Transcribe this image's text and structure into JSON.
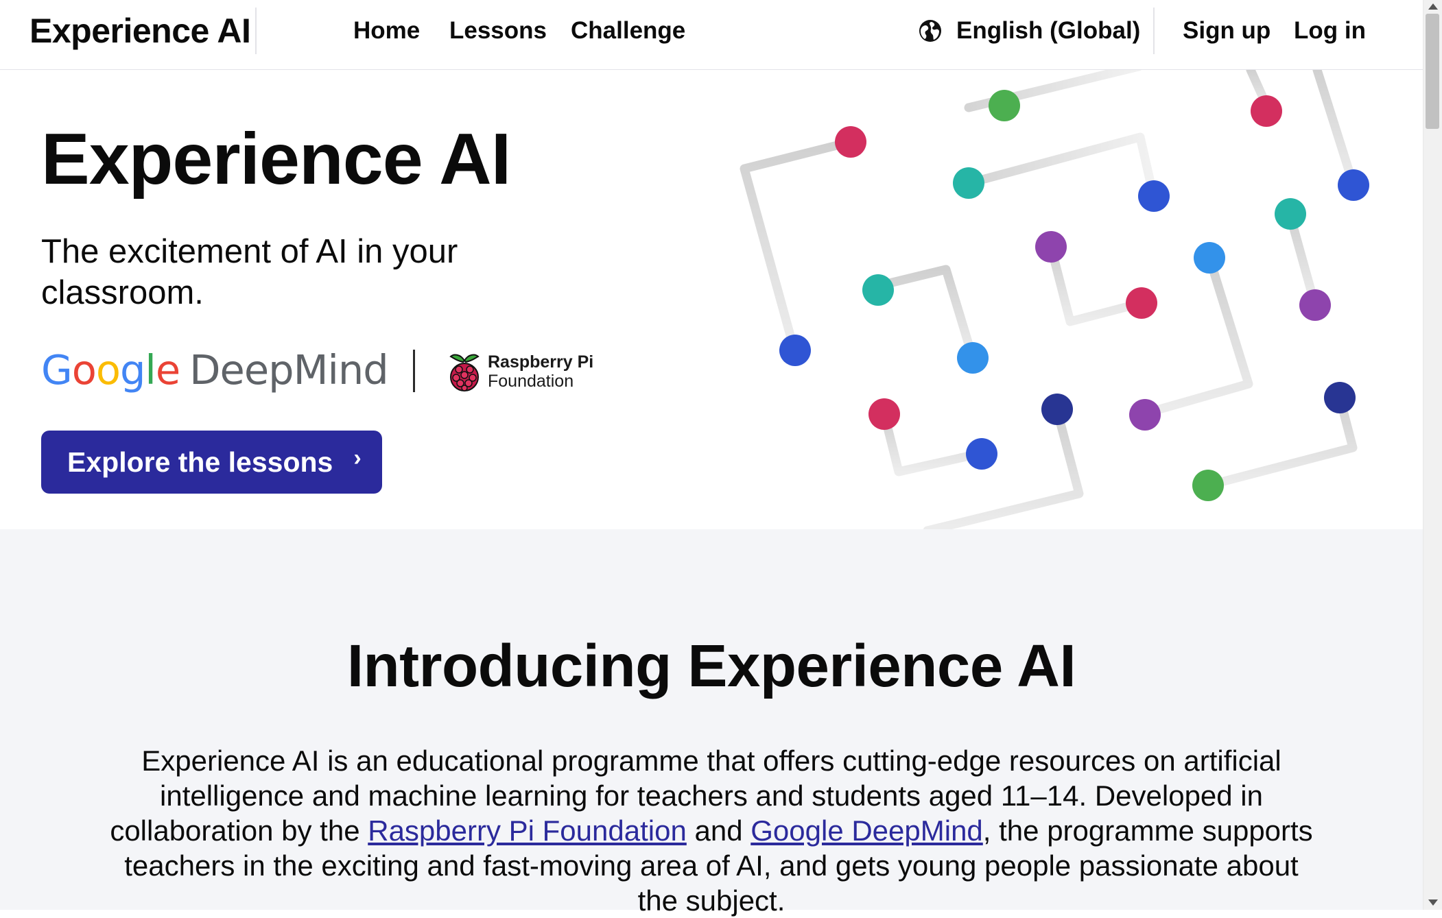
{
  "header": {
    "brand": "Experience AI",
    "nav": [
      {
        "label": "Home"
      },
      {
        "label": "Lessons"
      },
      {
        "label": "Challenge"
      }
    ],
    "language": {
      "label": "English (Global)",
      "icon": "globe-icon"
    },
    "sign_up": "Sign up",
    "log_in": "Log in"
  },
  "hero": {
    "title": "Experience AI",
    "subtitle": "The excitement of AI in your classroom.",
    "partner_logos": {
      "google_deepmind": {
        "google": "Google",
        "deepmind": "DeepMind"
      },
      "raspberry_pi": {
        "line1": "Raspberry Pi",
        "line2": "Foundation",
        "icon": "raspberry-icon"
      }
    },
    "cta": {
      "label": "Explore the lessons",
      "icon": "chevron-right-icon"
    }
  },
  "intro": {
    "title": "Introducing Experience AI",
    "body_part1": "Experience AI is an educational programme that offers cutting-edge resources on artificial intelligence and machine learning for teachers and students aged 11–14. Developed in collaboration by the ",
    "link1": "Raspberry Pi Foundation",
    "body_part2": " and ",
    "link2": "Google DeepMind",
    "body_part3": ", the programme supports teachers in the exciting and fast-moving area of AI, and gets young people passionate about the subject."
  },
  "colors": {
    "primary": "#2b2a9c",
    "intro_background": "#f4f5f8",
    "node_colors": [
      "#4caf50",
      "#d32f5f",
      "#26b5a6",
      "#2f55d4",
      "#8e44ad",
      "#3392ea",
      "#283593"
    ]
  }
}
